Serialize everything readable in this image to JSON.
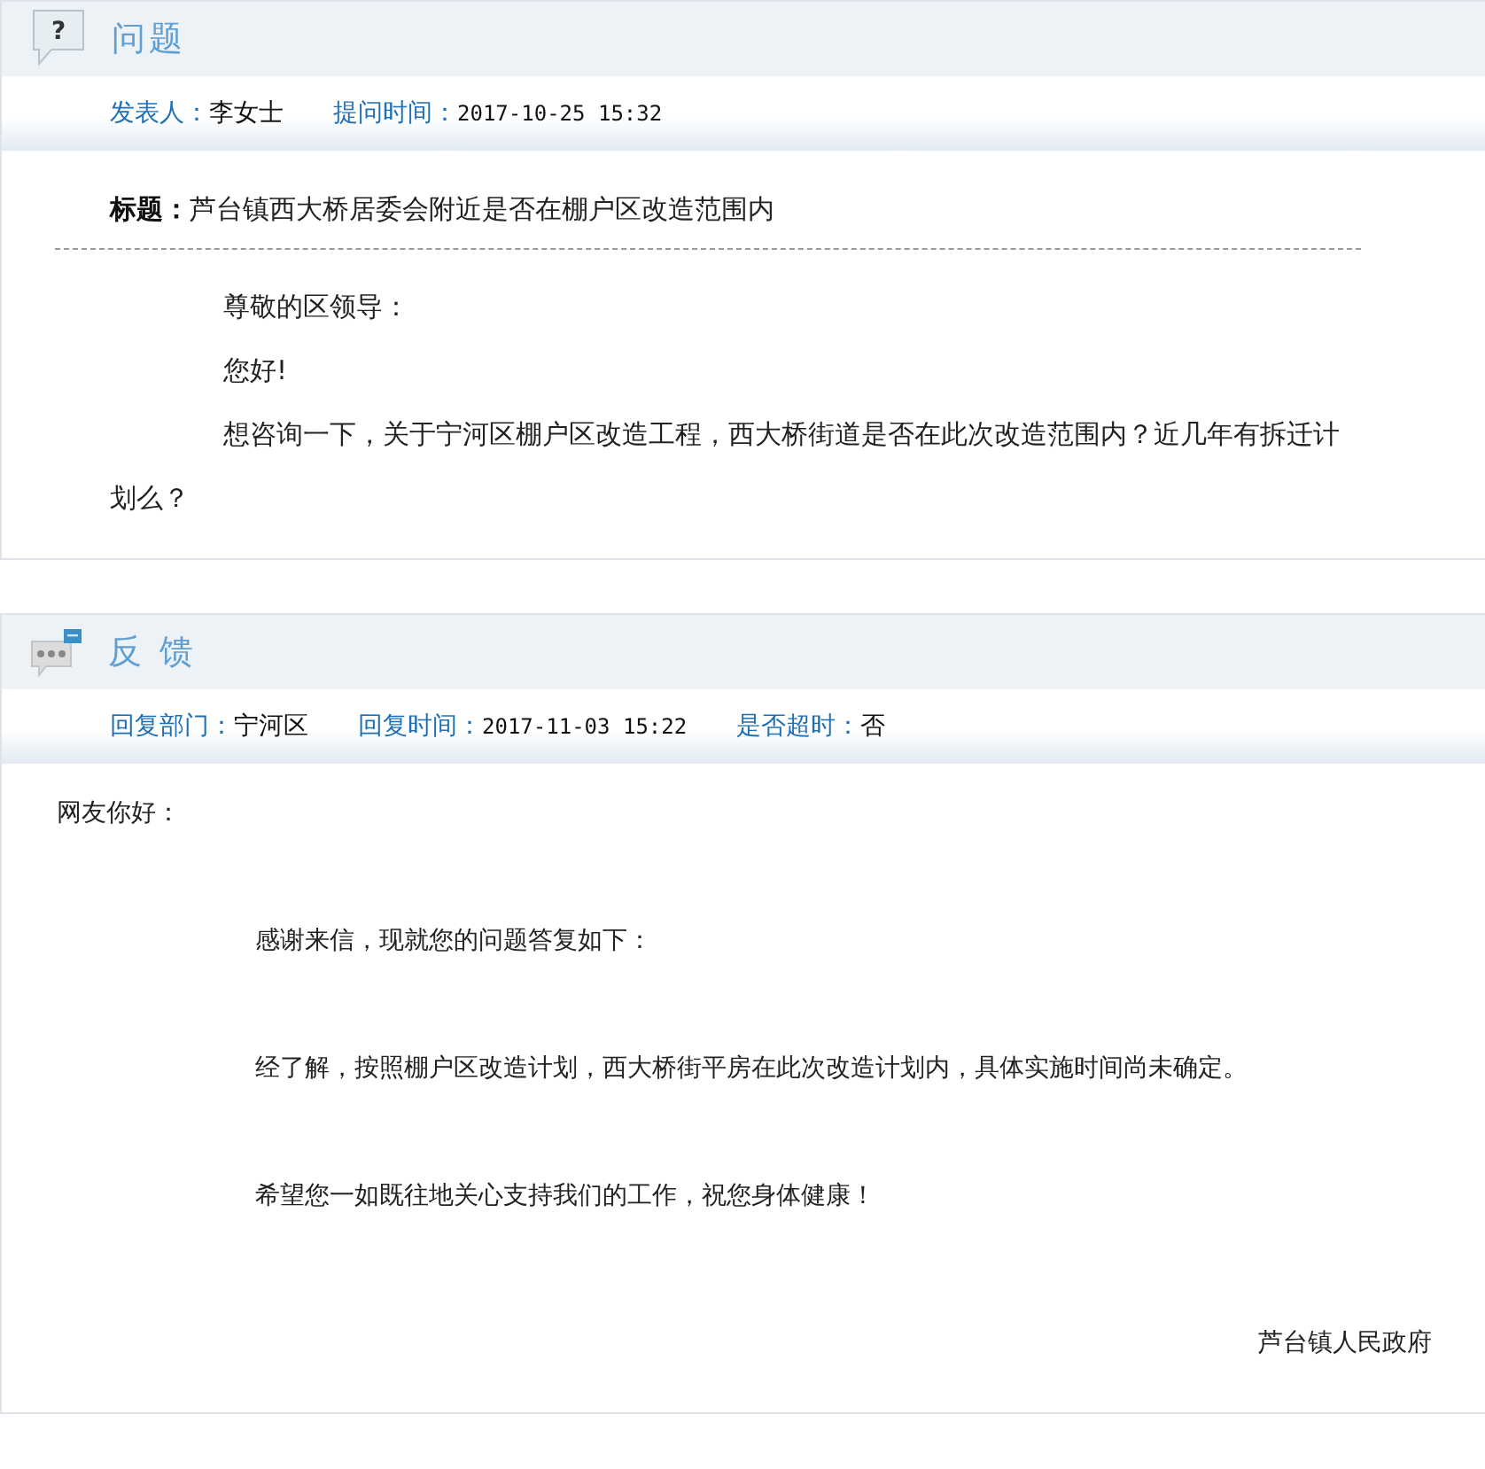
{
  "question": {
    "kind": "question",
    "icon_glyph": "?",
    "heading": "问题",
    "meta": [
      {
        "label": "发表人：",
        "value": "李女士",
        "kind": "text"
      },
      {
        "label": "提问时间：",
        "value": "2017-10-25 15:32",
        "kind": "time"
      }
    ],
    "title_label": "标题：",
    "title": "芦台镇西大桥居委会附近是否在棚户区改造范围内",
    "paragraphs": [
      "尊敬的区领导：",
      "您好!",
      "想咨询一下，关于宁河区棚户区改造工程，西大桥街道是否在此次改造范围内？近几年有拆迁计划么？"
    ]
  },
  "reply": {
    "kind": "chat",
    "heading": "反 馈",
    "meta": [
      {
        "label": "回复部门：",
        "value": "宁河区",
        "kind": "text"
      },
      {
        "label": "回复时间：",
        "value": "2017-11-03 15:22",
        "kind": "time"
      },
      {
        "label": "是否超时：",
        "value": "否",
        "kind": "text"
      }
    ],
    "greeting": "网友你好：",
    "paragraphs": [
      "感谢来信，现就您的问题答复如下：",
      "经了解，按照棚户区改造计划，西大桥街平房在此次改造计划内，具体实施时间尚未确定。",
      "希望您一如既往地关心支持我们的工作，祝您身体健康！"
    ],
    "signature": "芦台镇人民政府"
  }
}
